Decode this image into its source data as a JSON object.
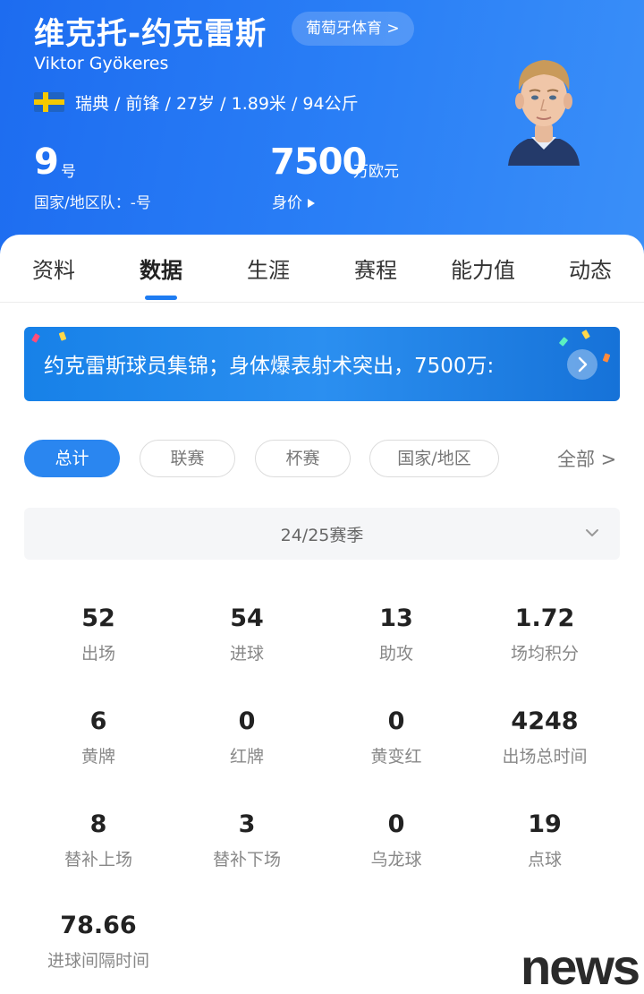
{
  "header": {
    "name_cn": "维克托-约克雷斯",
    "team_pill": "葡萄牙体育 >",
    "name_en": "Viktor Gyökeres",
    "country_flag_icon": "sweden-flag-icon",
    "meta": "瑞典 / 前锋 / 27岁 / 1.89米 / 94公斤",
    "shirt_number": "9",
    "shirt_unit": "号",
    "national_team": "国家/地区队：-号",
    "market_value": "7500",
    "market_value_unit": "万欧元",
    "market_value_label": "身价",
    "accent_color": "#1d6cf0"
  },
  "tabs": [
    "资料",
    "数据",
    "生涯",
    "赛程",
    "能力值",
    "动态"
  ],
  "active_tab": "数据",
  "banner": {
    "text": "约克雷斯球员集锦；身体爆表射术突出，7500万:"
  },
  "filters": {
    "chips": [
      "总计",
      "联赛",
      "杯赛",
      "国家/地区"
    ],
    "active": "总计",
    "all_label": "全部 >"
  },
  "season": {
    "selected": "24/25赛季"
  },
  "stats": [
    {
      "value": "52",
      "label": "出场"
    },
    {
      "value": "54",
      "label": "进球"
    },
    {
      "value": "13",
      "label": "助攻"
    },
    {
      "value": "1.72",
      "label": "场均积分"
    },
    {
      "value": "6",
      "label": "黄牌"
    },
    {
      "value": "0",
      "label": "红牌"
    },
    {
      "value": "0",
      "label": "黄变红"
    },
    {
      "value": "4248",
      "label": "出场总时间"
    },
    {
      "value": "8",
      "label": "替补上场"
    },
    {
      "value": "3",
      "label": "替补下场"
    },
    {
      "value": "0",
      "label": "乌龙球"
    },
    {
      "value": "19",
      "label": "点球"
    },
    {
      "value": "78.66",
      "label": "进球间隔时间"
    }
  ],
  "watermark": "news"
}
